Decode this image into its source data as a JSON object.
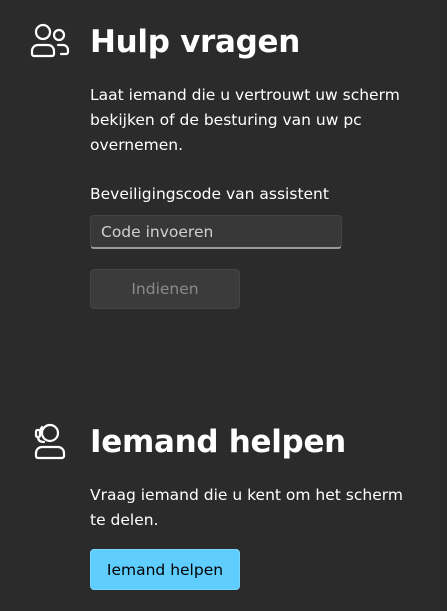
{
  "get_help": {
    "icon": "people-icon",
    "title": "Hulp vragen",
    "description": "Laat iemand die u vertrouwt uw scherm bekijken of de besturing van uw pc overnemen.",
    "code_label": "Beveiligingscode van assistent",
    "code_input": {
      "value": "",
      "placeholder": "Code invoeren"
    },
    "submit_label": "Indienen"
  },
  "give_help": {
    "icon": "person-headset-icon",
    "title": "Iemand helpen",
    "description": "Vraag iemand die u kent om het scherm te delen.",
    "button_label": "Iemand helpen"
  },
  "colors": {
    "background": "#2b2b2b",
    "accent": "#60cdff",
    "disabled_text": "#8a8a8a"
  }
}
